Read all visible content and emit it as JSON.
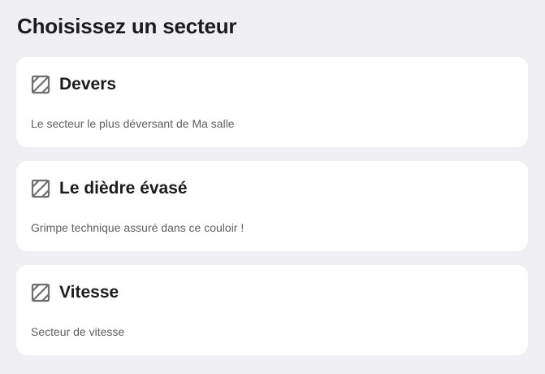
{
  "page": {
    "title": "Choisissez un secteur"
  },
  "sectors": [
    {
      "icon": "hatched-square-icon",
      "name": "Devers",
      "description": "Le secteur le plus déversant de Ma salle"
    },
    {
      "icon": "hatched-square-icon",
      "name": "Le dièdre évasé",
      "description": "Grimpe technique assuré dans ce couloir !"
    },
    {
      "icon": "hatched-square-icon",
      "name": "Vitesse",
      "description": "Secteur de vitesse"
    }
  ],
  "colors": {
    "background": "#efeff4",
    "card": "#ffffff",
    "title_text": "#1c1c1e",
    "description_text": "#5f5f63",
    "icon": "#6e6e73"
  }
}
